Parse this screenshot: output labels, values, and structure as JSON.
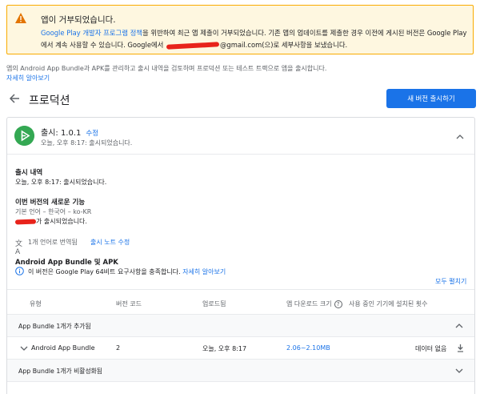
{
  "banner": {
    "title": "앱이 거부되었습니다.",
    "msg_link": "Google Play 개발자 프로그램 정책",
    "msg_part1": "을 위반하여 최근 앱 제출이 거부되었습니다. 기존 앱의 업데이트를 제출한 경우 이전에 게시된 버전은 Google Play에서 계속 사용할 수 있습니다. Google에서 ",
    "msg_part2": "@gmail.com(으)로 세부사항을 보냈습니다.",
    "colors": {
      "background": "#fef7e0",
      "border": "#f9ab00",
      "warning_icon": "#e37400"
    }
  },
  "intro": {
    "text": "앱의 Android App Bundle과 APK를 관리하고 출시 내역을 검토하며 프로덕션 또는 테스트 트랙으로 앱을 출시합니다.",
    "link": "자세히 알아보기"
  },
  "header": {
    "title": "프로덕션",
    "primary_button": "새 버전 출시하기"
  },
  "release": {
    "title": "출시: 1.0.1",
    "edit_link": "수정",
    "subtitle": "오늘, 오후 8:17: 출시되었습니다."
  },
  "history": {
    "title": "출시 내역",
    "text": "오늘, 오후 8:17: 출시되었습니다."
  },
  "whats_new": {
    "title": "이번 버전의 새로운 기능",
    "default_language": "기본 언어 – 한국어 – ko-KR",
    "text_suffix": "가 출시되었습니다."
  },
  "translation": {
    "text": "1개 언어로 번역됨",
    "link": "출시 노트 수정"
  },
  "bundle": {
    "title": "Android App Bundle 및 APK",
    "info_text": "이 버전은 Google Play 64비트 요구사항을 충족합니다. ",
    "info_link": "자세히 알아보기",
    "expand_all": "모두 펼치기"
  },
  "table": {
    "headers": [
      "유형",
      "버전 코드",
      "업로드됨",
      "앱 다운로드 크기",
      "사용 중인 기기에 설치된 횟수"
    ],
    "group_added": "App Bundle 1개가 추가됨",
    "group_deactivated": "App Bundle 1개가 비활성화됨",
    "row": {
      "type": "Android App Bundle",
      "version_code": "2",
      "uploaded": "오늘, 오후 8:17",
      "size": "2.06~2.10MB",
      "installs": "데이터 없음"
    }
  },
  "icons": {
    "warning": "warning-icon",
    "back": "arrow-back-icon",
    "release": "play-icon",
    "translate": "translate-icon",
    "info": "info-icon",
    "help": "help-icon",
    "download": "download-icon",
    "expand_more": "chevron-down-icon",
    "expand_less": "chevron-up-icon"
  },
  "colors": {
    "accent": "#1a73e8",
    "release_badge": "#34a853",
    "text": "#202124",
    "muted": "#5f6368"
  }
}
